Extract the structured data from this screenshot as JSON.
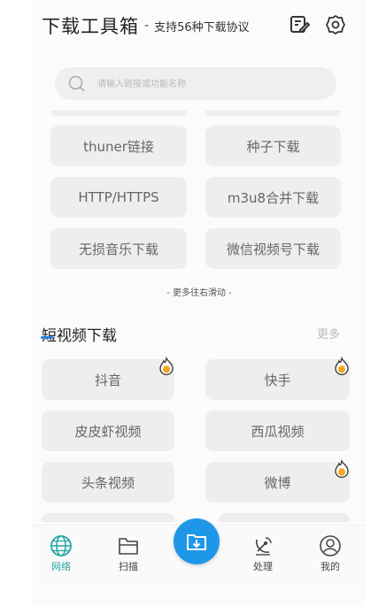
{
  "header": {
    "title": "下载工具箱",
    "separator": "-",
    "subtitle": "支持56种下载协议"
  },
  "search": {
    "placeholder": "请输入链接或功能名称"
  },
  "tools": [
    {
      "label": "thuner链接"
    },
    {
      "label": "种子下载"
    },
    {
      "label": "HTTP/HTTPS"
    },
    {
      "label": "m3u8合并下载"
    },
    {
      "label": "无损音乐下载"
    },
    {
      "label": "微信视频号下载"
    }
  ],
  "scroll_hint": "- 更多往右滑动 -",
  "short_video": {
    "title": "短视频下载",
    "more": "更多",
    "items": [
      {
        "label": "抖音",
        "hot": true
      },
      {
        "label": "快手",
        "hot": true
      },
      {
        "label": "皮皮虾视频",
        "hot": false
      },
      {
        "label": "西瓜视频",
        "hot": false
      },
      {
        "label": "头条视频",
        "hot": false
      },
      {
        "label": "微博",
        "hot": true
      }
    ]
  },
  "tabbar": {
    "active": "network",
    "tabs": [
      {
        "id": "network",
        "label": "网络",
        "icon": "globe-icon"
      },
      {
        "id": "scan",
        "label": "扫描",
        "icon": "folder-icon"
      },
      {
        "id": "download",
        "label": "",
        "icon": "download-icon"
      },
      {
        "id": "process",
        "label": "处理",
        "icon": "satellite-icon"
      },
      {
        "id": "mine",
        "label": "我的",
        "icon": "user-icon"
      }
    ]
  },
  "colors": {
    "accent": "#22a6a0",
    "fab": "#1f97e8",
    "hot": "#f5a623"
  }
}
